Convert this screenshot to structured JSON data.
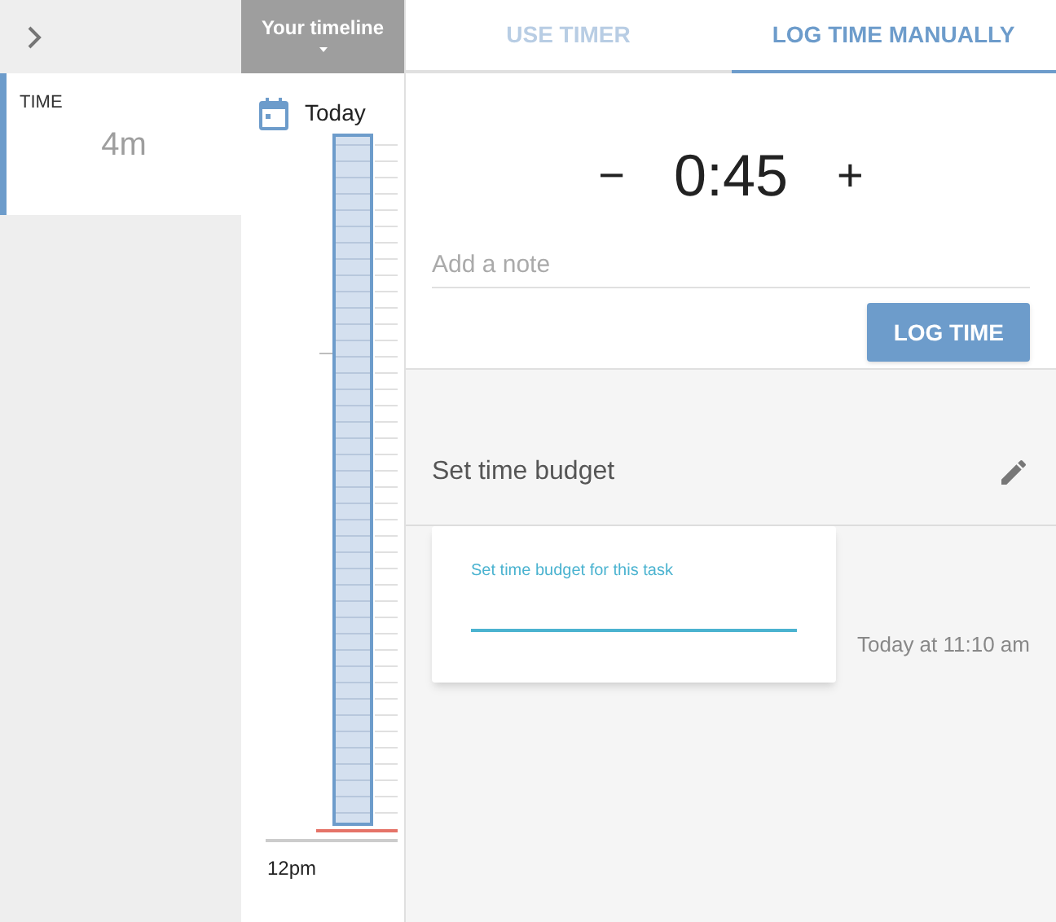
{
  "sidebar": {
    "card": {
      "label": "TIME",
      "value": "4m"
    }
  },
  "timeline": {
    "title": "Your timeline",
    "day": "Today",
    "hour_label": "12pm"
  },
  "tabs": [
    {
      "label": "USE TIMER",
      "selected": false
    },
    {
      "label": "LOG TIME MANUALLY",
      "selected": true
    }
  ],
  "manual": {
    "minus": "−",
    "duration": "0:45",
    "plus": "+",
    "note": {
      "placeholder": "Add a note"
    },
    "button": "LOG TIME"
  },
  "budget": {
    "label": "Set time budget"
  },
  "activity": {
    "time": "Today at 11:10 am"
  },
  "popup": {
    "field_label": "Set time budget for this task"
  }
}
